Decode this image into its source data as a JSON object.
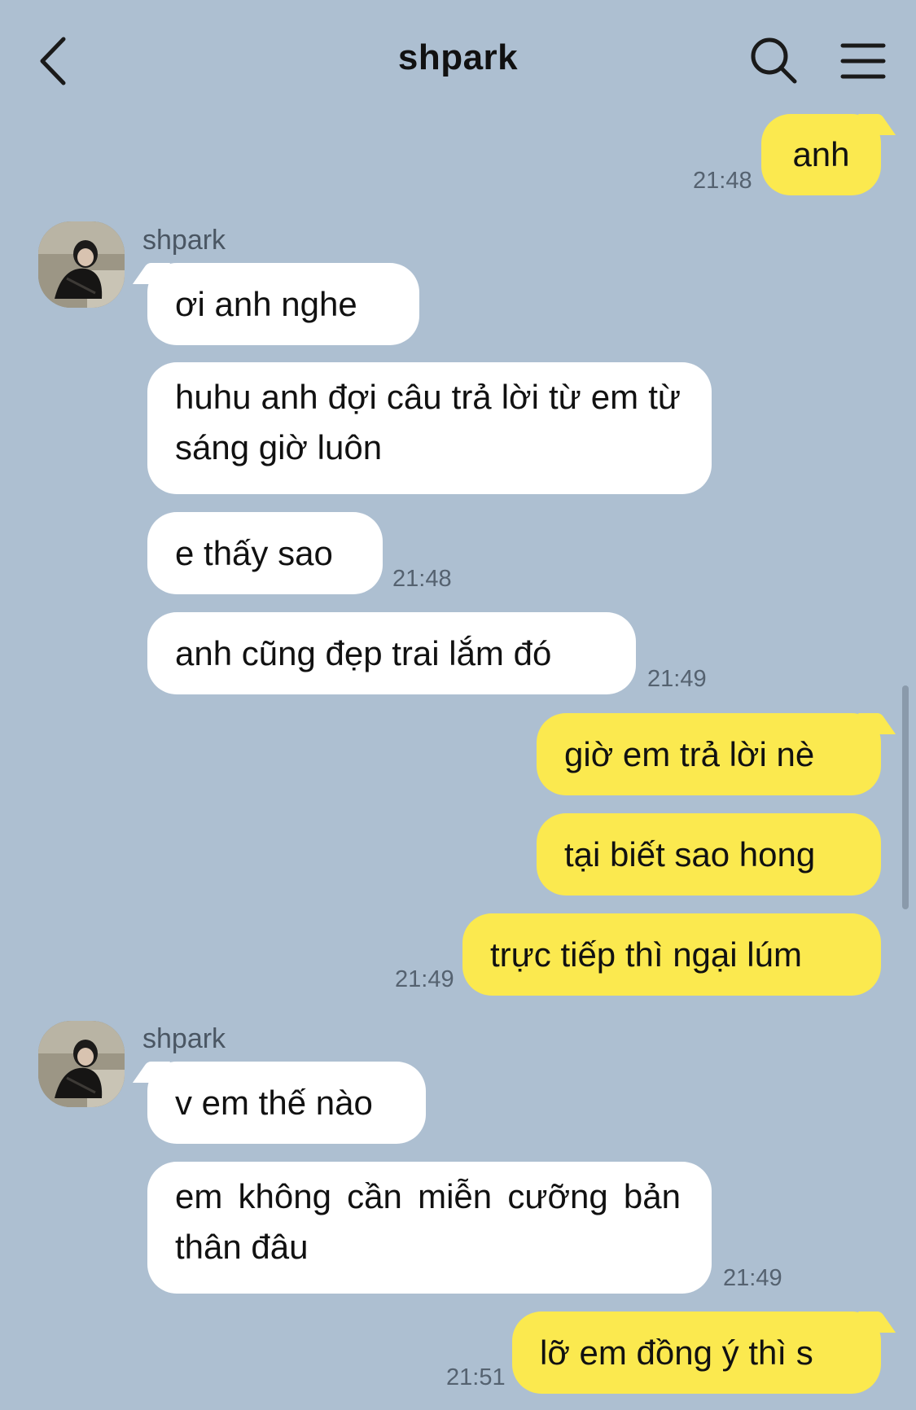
{
  "header": {
    "title": "shpark"
  },
  "icons": {
    "back": "chevron-left-icon",
    "search": "search-icon",
    "menu": "hamburger-menu-icon"
  },
  "colors": {
    "background": "#adbfd1",
    "incoming_bubble": "#ffffff",
    "outgoing_bubble": "#fbe94f"
  },
  "messages": [
    {
      "text": "anh",
      "time": "21:48",
      "from": "me"
    },
    {
      "sender": "shpark",
      "text": "ơi anh nghe"
    },
    {
      "text": "huhu anh đợi câu trả lời từ em từ sáng giờ luôn"
    },
    {
      "text": "e thấy sao",
      "time": "21:48"
    },
    {
      "text": "anh cũng đẹp trai lắm đó",
      "time": "21:49"
    },
    {
      "text": "giờ em trả lời nè",
      "from": "me"
    },
    {
      "text": "tại biết sao hong",
      "from": "me"
    },
    {
      "text": "trực tiếp thì ngại lúm",
      "time": "21:49",
      "from": "me"
    },
    {
      "sender": "shpark",
      "text": "v em thế nào"
    },
    {
      "text": "em không cần miễn cưỡng bản thân đâu",
      "time": "21:49"
    },
    {
      "text": "lỡ em đồng ý thì s",
      "time": "21:51",
      "from": "me"
    }
  ]
}
